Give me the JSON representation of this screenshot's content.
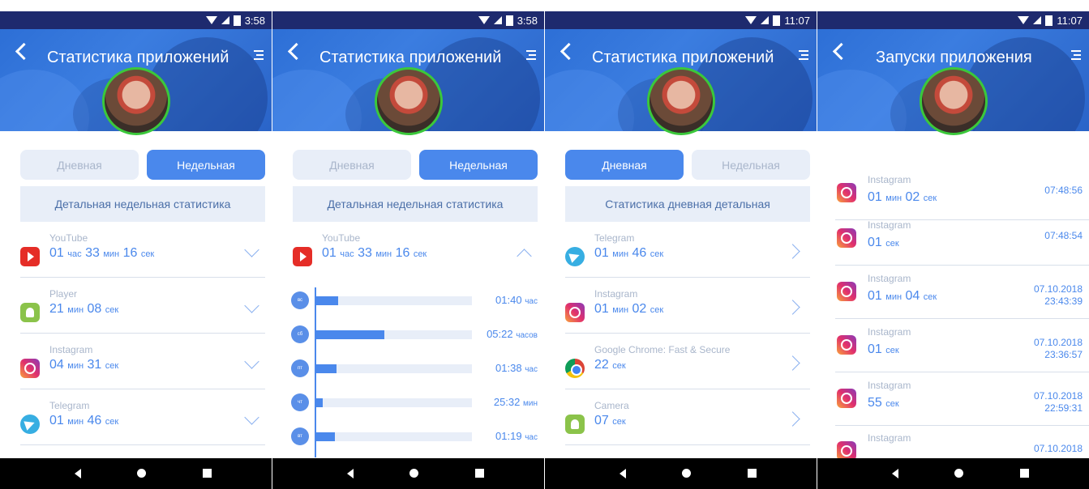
{
  "status": {
    "p1_time": "3:58",
    "p2_time": "3:58",
    "p3_time": "11:07",
    "p4_time": "11:07"
  },
  "titles": {
    "app_stats": "Статистика приложений",
    "launches": "Запуски приложения"
  },
  "tabs": {
    "daily": "Дневная",
    "weekly": "Недельная"
  },
  "detail": {
    "weekly": "Детальная недельная статистика",
    "daily": "Статистика дневная детальная"
  },
  "screen1": {
    "rows": [
      {
        "name": "YouTube",
        "d1": "01",
        "u1": "час",
        "d2": "33",
        "u2": "мин",
        "d3": "16",
        "u3": "сек",
        "icon": "youtube-icon"
      },
      {
        "name": "Player",
        "d1": "21",
        "u1": "мин",
        "d2": "08",
        "u2": "сек",
        "icon": "android-icon"
      },
      {
        "name": "Instagram",
        "d1": "04",
        "u1": "мин",
        "d2": "31",
        "u2": "сек",
        "icon": "instagram-icon"
      },
      {
        "name": "Telegram",
        "d1": "01",
        "u1": "мин",
        "d2": "46",
        "u2": "сек",
        "icon": "telegram-icon"
      }
    ]
  },
  "screen2": {
    "row": {
      "name": "YouTube",
      "d1": "01",
      "u1": "час",
      "d2": "33",
      "u2": "мин",
      "d3": "16",
      "u3": "сек"
    },
    "bars": [
      {
        "day": "вс",
        "value": "01:40",
        "unit": "час",
        "fraction": 0.14
      },
      {
        "day": "сб",
        "value": "05:22",
        "unit": "часов",
        "fraction": 0.44
      },
      {
        "day": "пт",
        "value": "01:38",
        "unit": "час",
        "fraction": 0.13
      },
      {
        "day": "чт",
        "value": "25:32",
        "unit": "мин",
        "fraction": 0.04
      },
      {
        "day": "вт",
        "value": "01:19",
        "unit": "час",
        "fraction": 0.12
      }
    ]
  },
  "screen3": {
    "rows": [
      {
        "name": "Telegram",
        "d1": "01",
        "u1": "мин",
        "d2": "46",
        "u2": "сек"
      },
      {
        "name": "Instagram",
        "d1": "01",
        "u1": "мин",
        "d2": "02",
        "u2": "сек"
      },
      {
        "name": "Google Chrome: Fast & Secure",
        "d1": "22",
        "u1": "сек"
      },
      {
        "name": "Camera",
        "d1": "07",
        "u1": "сек"
      }
    ]
  },
  "screen4": {
    "rows": [
      {
        "name": "Instagram",
        "d1": "01",
        "u1": "мин",
        "d2": "02",
        "u2": "сек",
        "date": "",
        "time": "07:48:56"
      },
      {
        "name": "Instagram",
        "d1": "01",
        "u1": "сек",
        "date": "",
        "time": "07:48:54"
      },
      {
        "name": "Instagram",
        "d1": "01",
        "u1": "мин",
        "d2": "04",
        "u2": "сек",
        "date": "07.10.2018",
        "time": "23:43:39"
      },
      {
        "name": "Instagram",
        "d1": "01",
        "u1": "сек",
        "date": "07.10.2018",
        "time": "23:36:57"
      },
      {
        "name": "Instagram",
        "d1": "55",
        "u1": "сек",
        "date": "07.10.2018",
        "time": "22:59:31"
      },
      {
        "name": "Instagram",
        "date": "07.10.2018"
      }
    ]
  }
}
